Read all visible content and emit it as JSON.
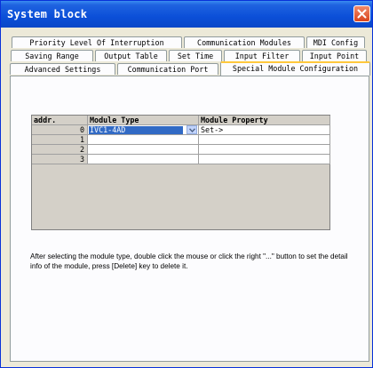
{
  "window": {
    "title": "System block",
    "close_label": "close"
  },
  "tabs": {
    "row1": [
      "Priority Level Of Interruption",
      "Communication Modules",
      "MDI Config"
    ],
    "row2": [
      "Saving Range",
      "Output Table",
      "Set Time",
      "Input Filter",
      "Input Point"
    ],
    "row3": [
      "Advanced Settings",
      "Communication Port",
      "Special Module Configuration"
    ],
    "active": "Special Module Configuration"
  },
  "grid": {
    "headers": {
      "addr": "addr.",
      "type": "Module Type",
      "prop": "Module Property"
    },
    "rows": [
      {
        "addr": "0",
        "type": "IVC1-4AD",
        "prop": "Set->"
      },
      {
        "addr": "1",
        "type": "",
        "prop": ""
      },
      {
        "addr": "2",
        "type": "",
        "prop": ""
      },
      {
        "addr": "3",
        "type": "",
        "prop": ""
      }
    ]
  },
  "help": "After selecting the module type, double click the mouse or click the right \"...\" button to set the detail info of the module, press [Delete] key to delete it."
}
